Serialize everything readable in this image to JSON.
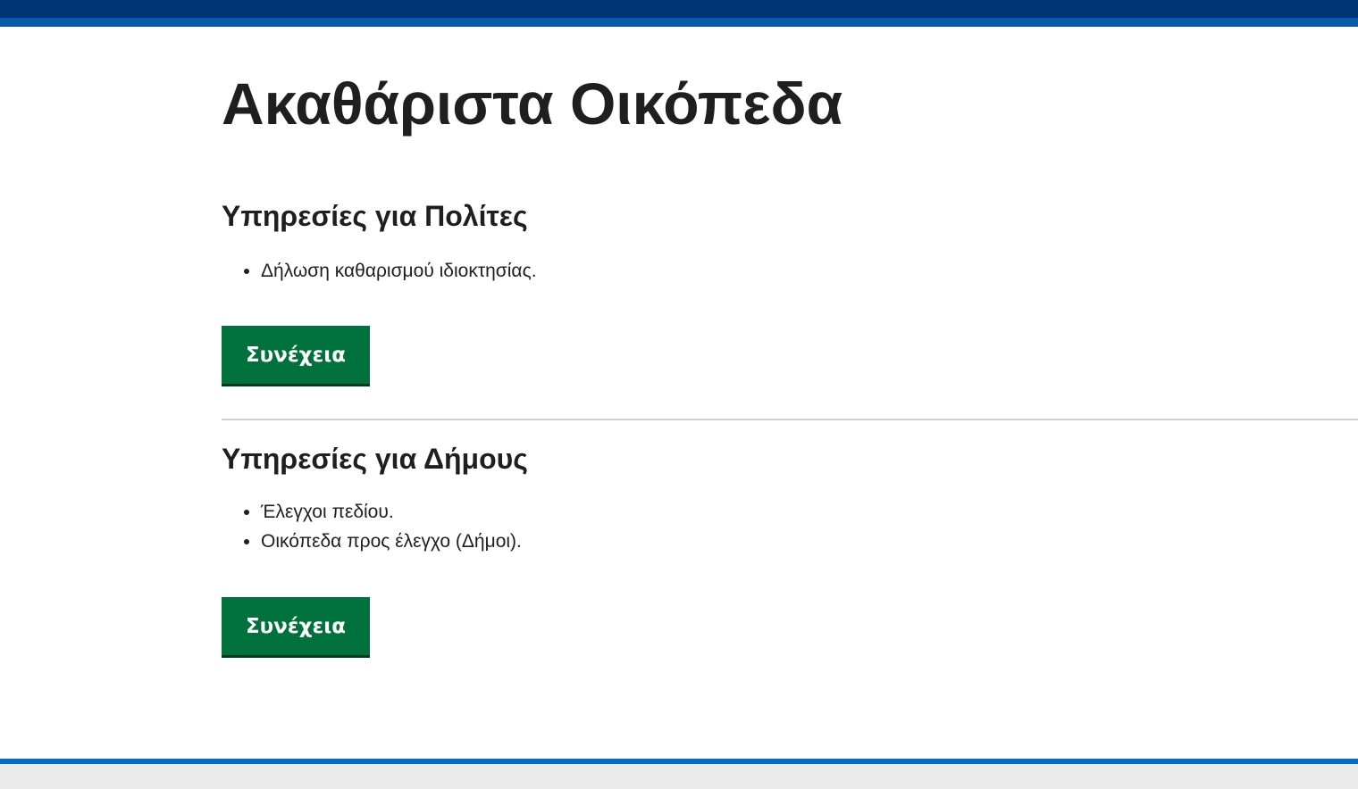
{
  "page": {
    "title": "Ακαθάριστα Οικόπεδα"
  },
  "citizens": {
    "heading": "Υπηρεσίες για Πολίτες",
    "items": [
      "Δήλωση καθαρισμού ιδιοκτησίας."
    ],
    "continue_label": "Συνέχεια"
  },
  "municipalities": {
    "heading": "Υπηρεσίες για Δήμους",
    "items": [
      "Έλεγχοι πεδίου.",
      "Οικόπεδα προς έλεγχο (Δήμοι)."
    ],
    "continue_label": "Συνέχεια"
  },
  "colors": {
    "header": "#003476",
    "header_stripe": "#0a5ca8",
    "button": "#00703c",
    "footer_border": "#046ec5",
    "footer_bg": "#ebebeb"
  }
}
